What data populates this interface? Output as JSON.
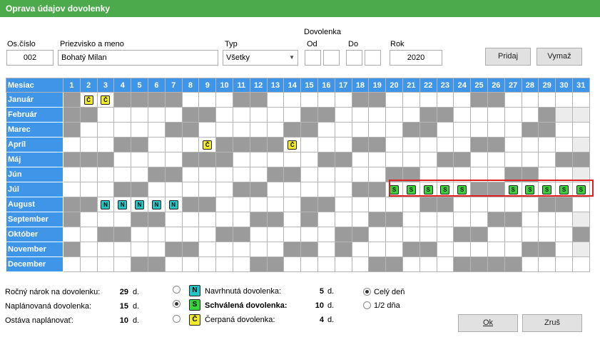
{
  "window": {
    "title": "Oprava údajov dovolenky"
  },
  "form": {
    "oscislo_label": "Os.číslo",
    "oscislo_value": "002",
    "name_label": "Priezvisko a meno",
    "name_value": "Bohatý Milan",
    "typ_label": "Typ",
    "typ_value": "Všetky",
    "dovolenka_label": "Dovolenka",
    "od_label": "Od",
    "do_label": "Do",
    "rok_label": "Rok",
    "rok_value": "2020",
    "pridaj_label": "Pridaj",
    "vymaz_label": "Vymaž"
  },
  "calendar": {
    "header_label": "Mesiac",
    "days": [
      "1",
      "2",
      "3",
      "4",
      "5",
      "6",
      "7",
      "8",
      "9",
      "10",
      "11",
      "12",
      "13",
      "14",
      "15",
      "16",
      "17",
      "18",
      "19",
      "20",
      "21",
      "22",
      "23",
      "24",
      "25",
      "26",
      "27",
      "28",
      "29",
      "30",
      "31"
    ],
    "months": [
      {
        "name": "Január",
        "weekend": [
          1,
          4,
          5,
          6,
          7,
          11,
          12,
          18,
          19,
          25,
          26
        ],
        "marks": {
          "2": "Č",
          "3": "Č"
        }
      },
      {
        "name": "Február",
        "weekend": [
          1,
          2,
          8,
          9,
          15,
          16,
          22,
          23,
          29
        ],
        "invalid": [
          30,
          31
        ],
        "marks": {}
      },
      {
        "name": "Marec",
        "weekend": [
          1,
          7,
          8,
          14,
          15,
          21,
          22,
          28,
          29
        ],
        "marks": {}
      },
      {
        "name": "Apríl",
        "weekend": [
          4,
          5,
          10,
          11,
          12,
          13,
          18,
          19,
          25,
          26
        ],
        "invalid": [
          31
        ],
        "marks": {
          "9": "Č",
          "14": "Č"
        }
      },
      {
        "name": "Máj",
        "weekend": [
          1,
          2,
          3,
          8,
          9,
          10,
          16,
          17,
          23,
          24,
          30,
          31
        ],
        "marks": {}
      },
      {
        "name": "Jún",
        "weekend": [
          6,
          7,
          13,
          14,
          20,
          21,
          27,
          28
        ],
        "invalid": [
          31
        ],
        "marks": {}
      },
      {
        "name": "Júl",
        "weekend": [
          4,
          5,
          11,
          12,
          18,
          19,
          25,
          26
        ],
        "marks": {
          "20": "S",
          "21": "S",
          "22": "S",
          "23": "S",
          "24": "S",
          "27": "S",
          "28": "S",
          "29": "S",
          "30": "S",
          "31": "S"
        }
      },
      {
        "name": "August",
        "weekend": [
          1,
          2,
          8,
          9,
          15,
          16,
          22,
          23,
          29,
          30
        ],
        "marks": {
          "4": "N",
          "5": "N",
          "6": "N",
          "7": "N",
          "3": "N"
        }
      },
      {
        "name": "September",
        "weekend": [
          1,
          5,
          6,
          12,
          13,
          15,
          19,
          20,
          26,
          27
        ],
        "invalid": [
          31
        ],
        "marks": {}
      },
      {
        "name": "Október",
        "weekend": [
          3,
          4,
          10,
          11,
          17,
          18,
          24,
          25,
          31
        ],
        "marks": {}
      },
      {
        "name": "November",
        "weekend": [
          1,
          7,
          8,
          14,
          15,
          17,
          21,
          22,
          28,
          29
        ],
        "invalid": [
          31
        ],
        "marks": {}
      },
      {
        "name": "December",
        "weekend": [
          5,
          6,
          12,
          13,
          19,
          20,
          24,
          25,
          26,
          27
        ],
        "marks": {}
      }
    ]
  },
  "summary": {
    "rocny_label": "Ročný nárok na dovolenku:",
    "rocny_value": "29",
    "planovana_label": "Naplánovaná dovolenka:",
    "planovana_value": "15",
    "ostava_label": "Ostáva naplánovať:",
    "ostava_value": "10",
    "unit": "d."
  },
  "legend": {
    "navrhnuta_label": "Navrhnutá dovolenka:",
    "navrhnuta_value": "5",
    "navrhnuta_symbol": "N",
    "schvalena_label": "Schválená dovolenka:",
    "schvalena_value": "10",
    "schvalena_symbol": "S",
    "cerpana_label": "Čerpaná dovolenka:",
    "cerpana_value": "4",
    "cerpana_symbol": "Č",
    "unit": "d."
  },
  "options": {
    "cely_den_label": "Celý deň",
    "pol_dna_label": "1/2 dňa"
  },
  "buttons": {
    "ok_label": "Ok",
    "zrus_label": "Zruš"
  },
  "colors": {
    "title_bar": "#4caa4c",
    "header_blue": "#3f95e8",
    "weekend_gray": "#9b9b9b",
    "approved_green": "#3bd23b",
    "proposed_cyan": "#27c3c3",
    "used_yellow": "#f0ea2a",
    "highlight_red": "#e21d1d"
  }
}
